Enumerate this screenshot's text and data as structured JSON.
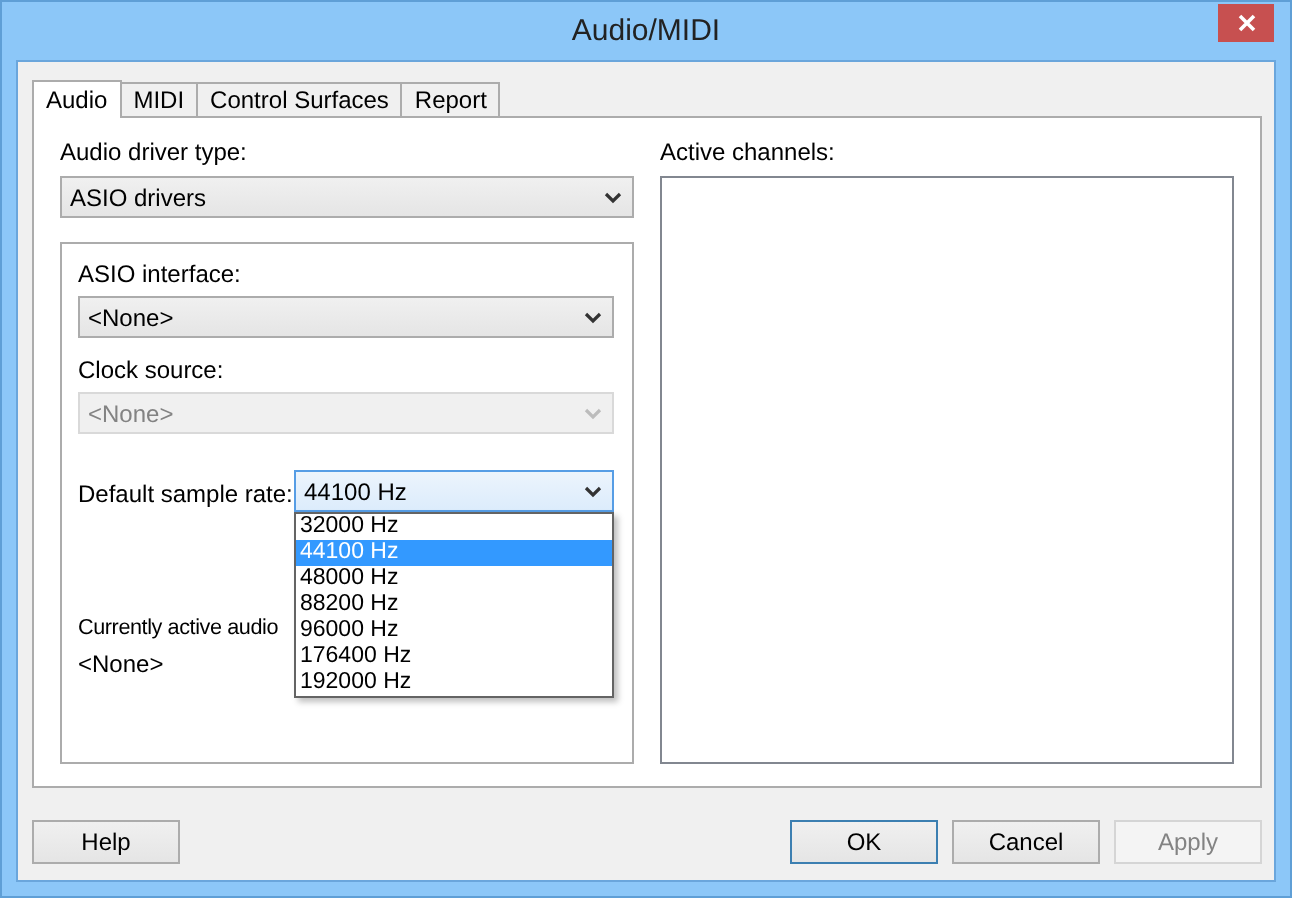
{
  "window": {
    "title": "Audio/MIDI"
  },
  "tabs": [
    {
      "label": "Audio",
      "selected": true
    },
    {
      "label": "MIDI",
      "selected": false
    },
    {
      "label": "Control Surfaces",
      "selected": false
    },
    {
      "label": "Report",
      "selected": false
    }
  ],
  "audio_driver": {
    "label": "Audio driver type:",
    "value": "ASIO drivers",
    "disabled": false
  },
  "asio_interface": {
    "label": "ASIO interface:",
    "value": "<None>",
    "disabled": false
  },
  "clock_source": {
    "label": "Clock source:",
    "value": "<None>",
    "disabled": true
  },
  "sample_rate": {
    "label": "Default sample rate:",
    "value": "44100 Hz",
    "disabled": false,
    "expanded": true,
    "options": [
      {
        "label": "32000 Hz",
        "selected": false
      },
      {
        "label": "44100 Hz",
        "selected": true
      },
      {
        "label": "48000 Hz",
        "selected": false
      },
      {
        "label": "88200 Hz",
        "selected": false
      },
      {
        "label": "96000 Hz",
        "selected": false
      },
      {
        "label": "176400 Hz",
        "selected": false
      },
      {
        "label": "192000 Hz",
        "selected": false
      }
    ]
  },
  "current_device": {
    "label": "Currently active audio",
    "value": "<None>"
  },
  "active_channels": {
    "label": "Active channels:"
  },
  "buttons": [
    {
      "label": "Help",
      "default": false,
      "disabled": false
    },
    {
      "label": "OK",
      "default": true,
      "disabled": false
    },
    {
      "label": "Cancel",
      "default": false,
      "disabled": false
    },
    {
      "label": "Apply",
      "default": false,
      "disabled": true
    }
  ]
}
